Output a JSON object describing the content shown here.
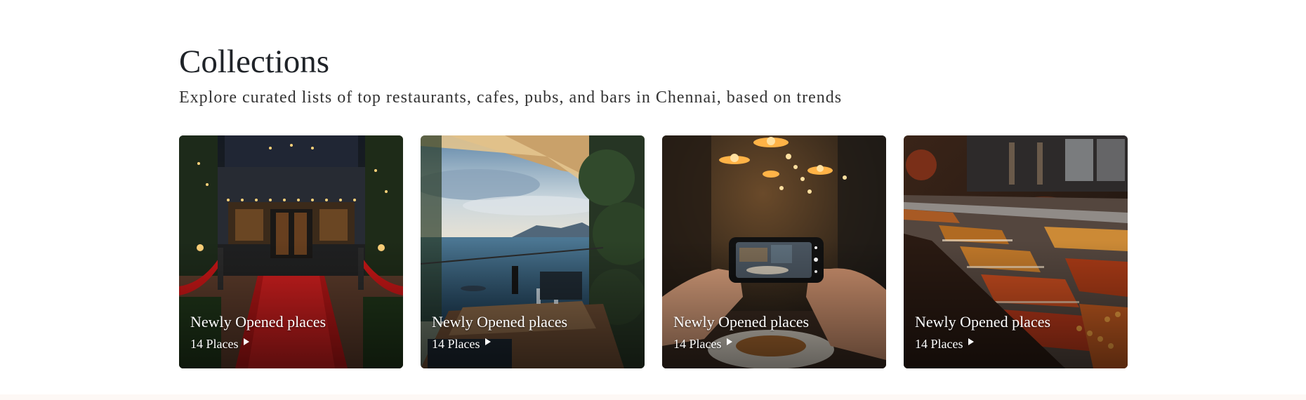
{
  "collections": {
    "title": "Collections",
    "subtitle": "Explore curated lists of top restaurants, cafes, pubs, and bars in Chennai, based on trends",
    "cards": [
      {
        "title": "Newly Opened places",
        "places": "14 Places",
        "icon": "play-triangle-icon"
      },
      {
        "title": "Newly Opened places",
        "places": "14 Places",
        "icon": "play-triangle-icon"
      },
      {
        "title": "Newly Opened places",
        "places": "14 Places",
        "icon": "play-triangle-icon"
      },
      {
        "title": "Newly Opened places",
        "places": "14 Places",
        "icon": "play-triangle-icon"
      }
    ]
  }
}
